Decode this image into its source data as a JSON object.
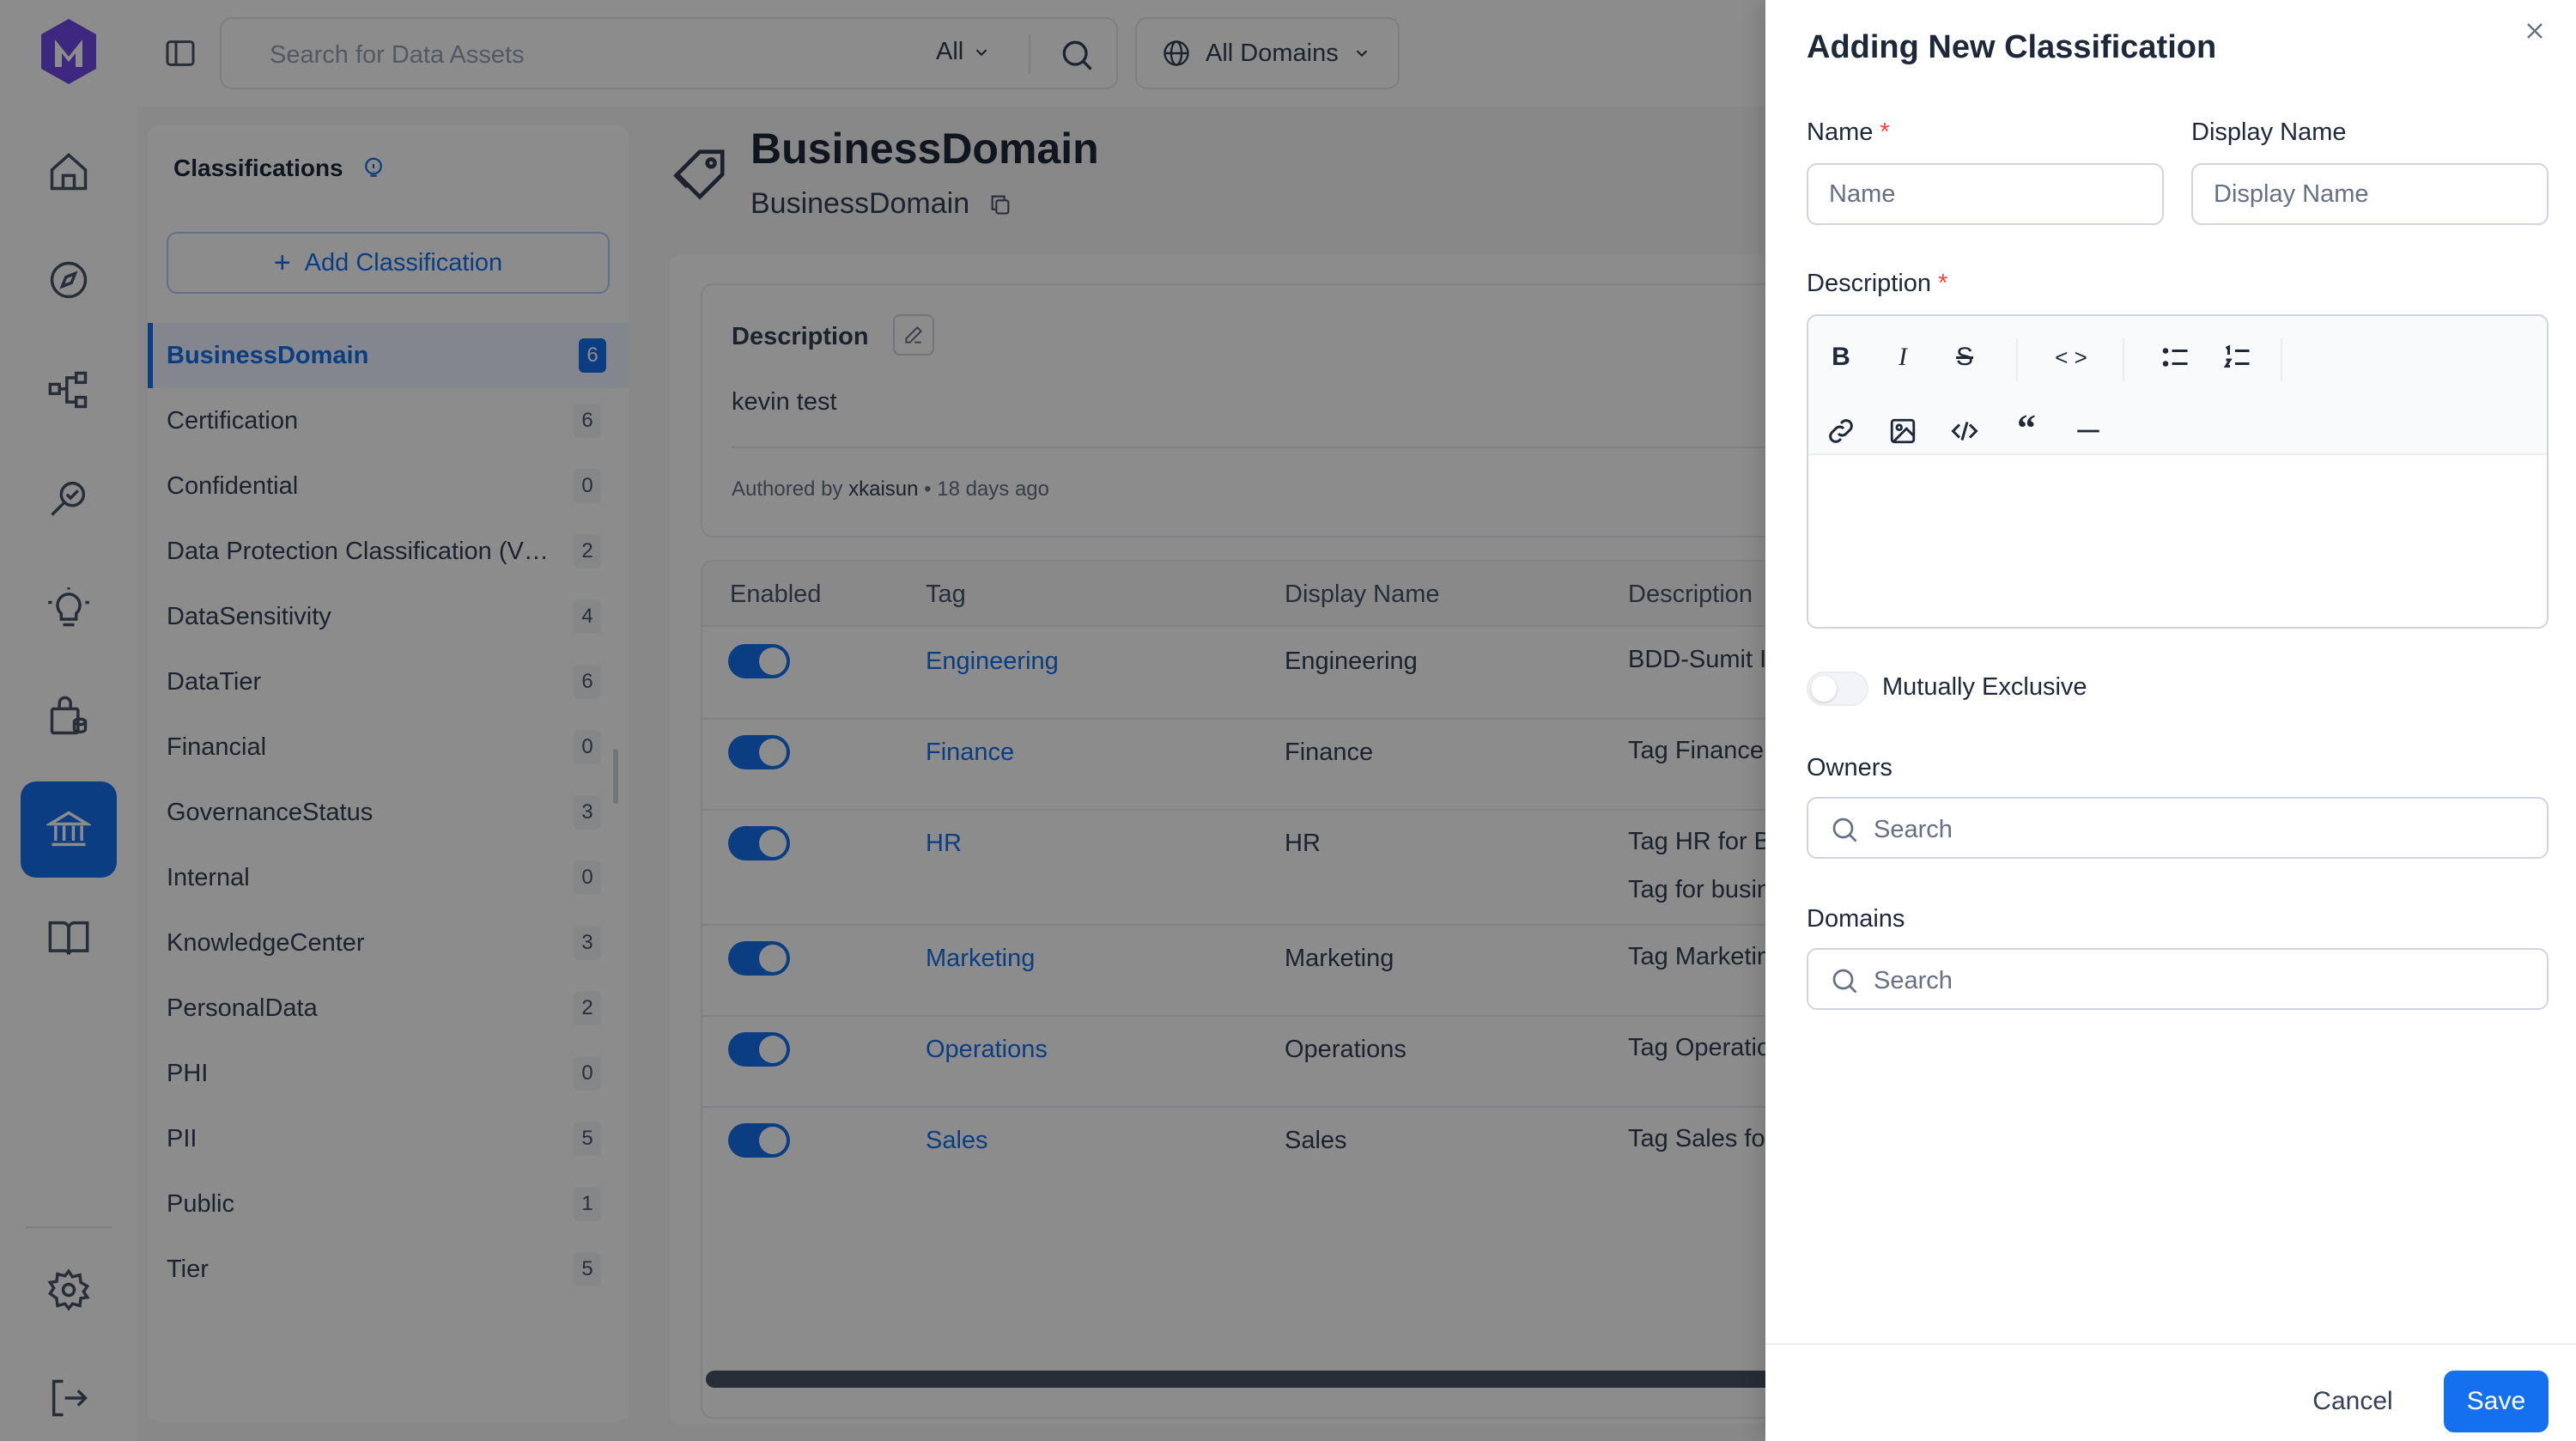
{
  "topbar": {
    "search_placeholder": "Search for Data Assets",
    "search_scope": "All",
    "domains_label": "All Domains"
  },
  "classifications": {
    "title": "Classifications",
    "add_label": "Add Classification",
    "items": [
      {
        "name": "BusinessDomain",
        "count": "6"
      },
      {
        "name": "Certification",
        "count": "6"
      },
      {
        "name": "Confidential",
        "count": "0"
      },
      {
        "name": "Data Protection Classification (VC...",
        "count": "2"
      },
      {
        "name": "DataSensitivity",
        "count": "4"
      },
      {
        "name": "DataTier",
        "count": "6"
      },
      {
        "name": "Financial",
        "count": "0"
      },
      {
        "name": "GovernanceStatus",
        "count": "3"
      },
      {
        "name": "Internal",
        "count": "0"
      },
      {
        "name": "KnowledgeCenter",
        "count": "3"
      },
      {
        "name": "PersonalData",
        "count": "2"
      },
      {
        "name": "PHI",
        "count": "0"
      },
      {
        "name": "PII",
        "count": "5"
      },
      {
        "name": "Public",
        "count": "1"
      },
      {
        "name": "Tier",
        "count": "5"
      }
    ]
  },
  "main": {
    "title": "BusinessDomain",
    "subtitle": "BusinessDomain",
    "description_label": "Description",
    "description_text": "kevin test",
    "authored_by_label": "Authored by",
    "author": "xkaisun",
    "time_ago": "18 days ago",
    "table": {
      "headers": [
        "Enabled",
        "Tag",
        "Display Name",
        "Description"
      ],
      "rows": [
        {
          "tag": "Engineering",
          "display": "Engineering",
          "desc": "BDD-Sumit India",
          "desc2": ""
        },
        {
          "tag": "Finance",
          "display": "Finance",
          "desc": "Tag Finance for B",
          "desc2": ""
        },
        {
          "tag": "HR",
          "display": "HR",
          "desc": "Tag HR for Busin",
          "desc2": "Tag for business"
        },
        {
          "tag": "Marketing",
          "display": "Marketing",
          "desc": "Tag Marketing fo",
          "desc2": ""
        },
        {
          "tag": "Operations",
          "display": "Operations",
          "desc": "Tag Operations fo",
          "desc2": ""
        },
        {
          "tag": "Sales",
          "display": "Sales",
          "desc": "Tag Sales for Bus",
          "desc2": ""
        }
      ]
    }
  },
  "drawer": {
    "title": "Adding New Classification",
    "name_label": "Name",
    "name_placeholder": "Name",
    "display_name_label": "Display Name",
    "display_name_placeholder": "Display Name",
    "description_label": "Description",
    "required_mark": "*",
    "mutually_exclusive_label": "Mutually Exclusive",
    "owners_label": "Owners",
    "owners_placeholder": "Search",
    "domains_label": "Domains",
    "domains_placeholder": "Search",
    "cancel_label": "Cancel",
    "save_label": "Save"
  },
  "colors": {
    "accent": "#1570ef",
    "required": "#f04438",
    "overlay": "rgba(0,0,0,0.45)"
  }
}
